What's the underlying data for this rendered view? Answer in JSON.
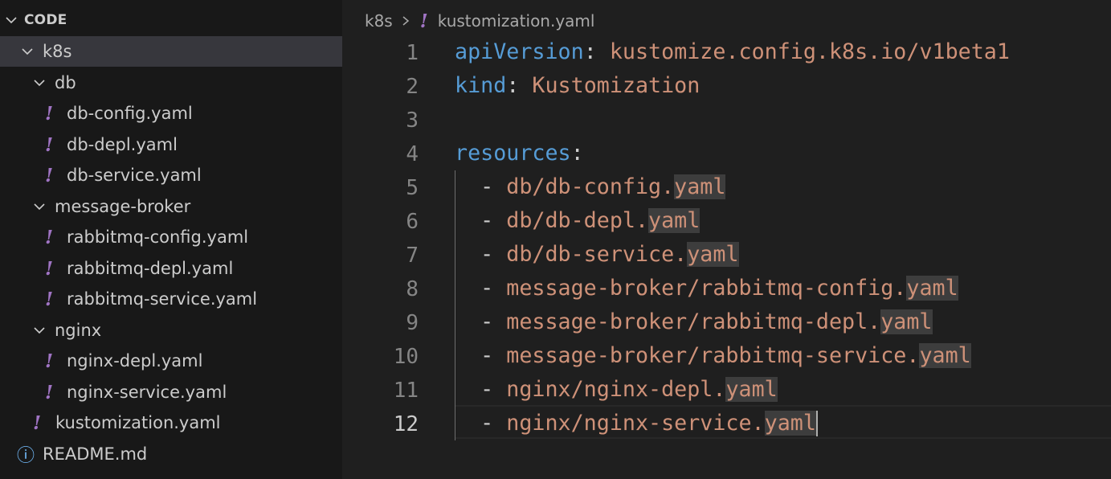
{
  "explorer": {
    "root_label": "CODE",
    "items": [
      {
        "label": "k8s",
        "kind": "folder"
      },
      {
        "label": "db",
        "kind": "folder"
      },
      {
        "label": "db-config.yaml",
        "kind": "yaml"
      },
      {
        "label": "db-depl.yaml",
        "kind": "yaml"
      },
      {
        "label": "db-service.yaml",
        "kind": "yaml"
      },
      {
        "label": "message-broker",
        "kind": "folder"
      },
      {
        "label": "rabbitmq-config.yaml",
        "kind": "yaml"
      },
      {
        "label": "rabbitmq-depl.yaml",
        "kind": "yaml"
      },
      {
        "label": "rabbitmq-service.yaml",
        "kind": "yaml"
      },
      {
        "label": "nginx",
        "kind": "folder"
      },
      {
        "label": "nginx-depl.yaml",
        "kind": "yaml"
      },
      {
        "label": "nginx-service.yaml",
        "kind": "yaml"
      },
      {
        "label": "kustomization.yaml",
        "kind": "yaml"
      },
      {
        "label": "README.md",
        "kind": "info"
      }
    ],
    "yaml_icon_glyph": "!",
    "info_icon_glyph": "ⓘ"
  },
  "editor": {
    "breadcrumb": {
      "folder": "k8s",
      "file": "kustomization.yaml"
    },
    "lines": [
      {
        "num": "1",
        "key": "apiVersion",
        "colon": ":",
        "value": " kustomize.config.k8s.io/v1beta1"
      },
      {
        "num": "2",
        "key": "kind",
        "colon": ":",
        "value": " Kustomization"
      },
      {
        "num": "3"
      },
      {
        "num": "4",
        "key": "resources",
        "colon": ":"
      },
      {
        "num": "5",
        "dash": "  - ",
        "path": "db/db-config.",
        "ext": "yaml"
      },
      {
        "num": "6",
        "dash": "  - ",
        "path": "db/db-depl.",
        "ext": "yaml"
      },
      {
        "num": "7",
        "dash": "  - ",
        "path": "db/db-service.",
        "ext": "yaml"
      },
      {
        "num": "8",
        "dash": "  - ",
        "path": "message-broker/rabbitmq-config.",
        "ext": "yaml"
      },
      {
        "num": "9",
        "dash": "  - ",
        "path": "message-broker/rabbitmq-depl.",
        "ext": "yaml"
      },
      {
        "num": "10",
        "dash": "  - ",
        "path": "message-broker/rabbitmq-service.",
        "ext": "yaml"
      },
      {
        "num": "11",
        "dash": "  - ",
        "path": "nginx/nginx-depl.",
        "ext": "yaml"
      },
      {
        "num": "12",
        "dash": "  - ",
        "path": "nginx/nginx-service.",
        "ext": "yaml"
      }
    ]
  },
  "colors": {
    "key": "#569cd6",
    "string": "#ce9178",
    "yaml_icon": "#a074c4",
    "info_icon": "#75beff",
    "selection_highlight": "#3d3d3d"
  }
}
